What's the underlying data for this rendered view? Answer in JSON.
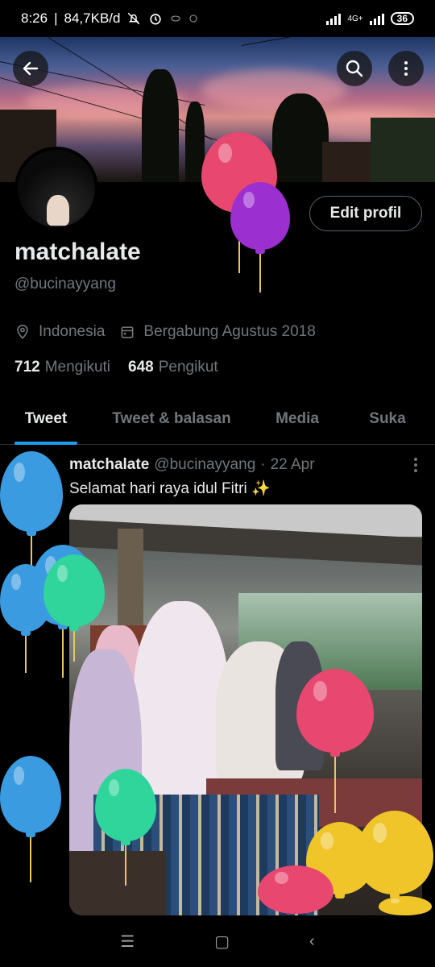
{
  "status_bar": {
    "time": "8:26",
    "network_speed": "84,7KB/d",
    "network_type": "4G+",
    "battery": "36"
  },
  "header": {
    "back_icon": "arrow-left-icon",
    "search_icon": "search-icon",
    "more_icon": "more-vertical-icon"
  },
  "profile": {
    "edit_button": "Edit profil",
    "display_name": "matchalate",
    "handle": "@bucinayyang",
    "location": "Indonesia",
    "joined": "Bergabung Agustus 2018",
    "following_count": "712",
    "following_label": "Mengikuti",
    "followers_count": "648",
    "followers_label": "Pengikut"
  },
  "tabs": [
    {
      "label": "Tweet",
      "active": true
    },
    {
      "label": "Tweet & balasan",
      "active": false
    },
    {
      "label": "Media",
      "active": false
    },
    {
      "label": "Suka",
      "active": false
    }
  ],
  "tweet": {
    "name": "matchalate",
    "handle": "@bucinayyang",
    "separator": "·",
    "date": "22 Apr",
    "text": "Selamat hari raya idul Fitri ✨"
  },
  "colors": {
    "accent": "#1d9bf0",
    "text_primary": "#e7e9ea",
    "text_secondary": "#71767b",
    "background": "#000000"
  }
}
